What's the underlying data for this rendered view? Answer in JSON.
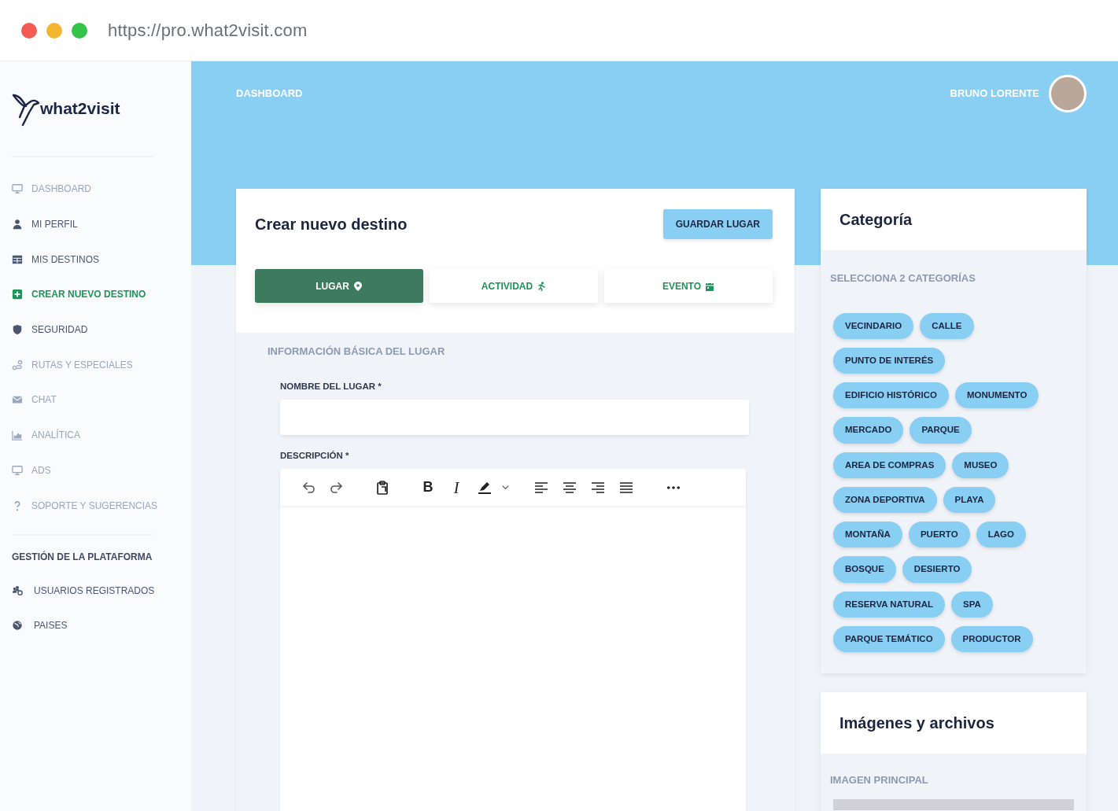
{
  "browser": {
    "url": "https://pro.what2visit.com"
  },
  "sidebar": {
    "logo": "what2visit",
    "items": [
      {
        "label": "DASHBOARD",
        "disabled": true,
        "selected": false
      },
      {
        "label": "MI PERFIL",
        "disabled": false,
        "selected": false
      },
      {
        "label": "MIS DESTINOS",
        "disabled": false,
        "selected": false
      },
      {
        "label": "CREAR NUEVO DESTINO",
        "disabled": false,
        "selected": true
      },
      {
        "label": "SEGURIDAD",
        "disabled": false,
        "selected": false
      },
      {
        "label": "RUTAS Y ESPECIALES",
        "disabled": true,
        "selected": false
      },
      {
        "label": "CHAT",
        "disabled": true,
        "selected": false
      },
      {
        "label": "ANALÍTICA",
        "disabled": true,
        "selected": false
      },
      {
        "label": "ADS",
        "disabled": true,
        "selected": false
      },
      {
        "label": "SOPORTE Y SUGERENCIAS",
        "disabled": true,
        "selected": false
      }
    ],
    "section_title": "GESTIÓN DE LA PLATAFORMA",
    "admin_items": [
      {
        "label": "USUARIOS REGISTRADOS"
      },
      {
        "label": "PAISES"
      }
    ]
  },
  "header": {
    "breadcrumb": "DASHBOARD",
    "user_name": "BRUNO LORENTE"
  },
  "form": {
    "title": "Crear nuevo destino",
    "save_button": "GUARDAR LUGAR",
    "tabs": [
      {
        "label": "LUGAR",
        "selected": true
      },
      {
        "label": "ACTIVIDAD",
        "selected": false
      },
      {
        "label": "EVENTO",
        "selected": false
      }
    ],
    "section_title": "INFORMACIÓN BÁSICA DEL LUGAR",
    "name_label": "NOMBRE DEL LUGAR *",
    "description_label": "DESCRIPCIÓN *",
    "editor": {
      "bold": "B",
      "italic": "I"
    }
  },
  "categories": {
    "title": "Categoría",
    "hint": "SELECCIONA 2 CATEGORÍAS",
    "chips": [
      "VECINDARIO",
      "CALLE",
      "PUNTO DE INTERÉS",
      "EDIFICIO HISTÓRICO",
      "MONUMENTO",
      "MERCADO",
      "PARQUE",
      "AREA DE COMPRAS",
      "MUSEO",
      "ZONA DEPORTIVA",
      "PLAYA",
      "MONTAÑA",
      "PUERTO",
      "LAGO",
      "BOSQUE",
      "DESIERTO",
      "RESERVA NATURAL",
      "SPA",
      "PARQUE TEMÁTICO",
      "PRODUCTOR"
    ]
  },
  "media": {
    "title": "Imágenes y archivos",
    "main_image_label": "IMAGEN PRINCIPAL"
  }
}
